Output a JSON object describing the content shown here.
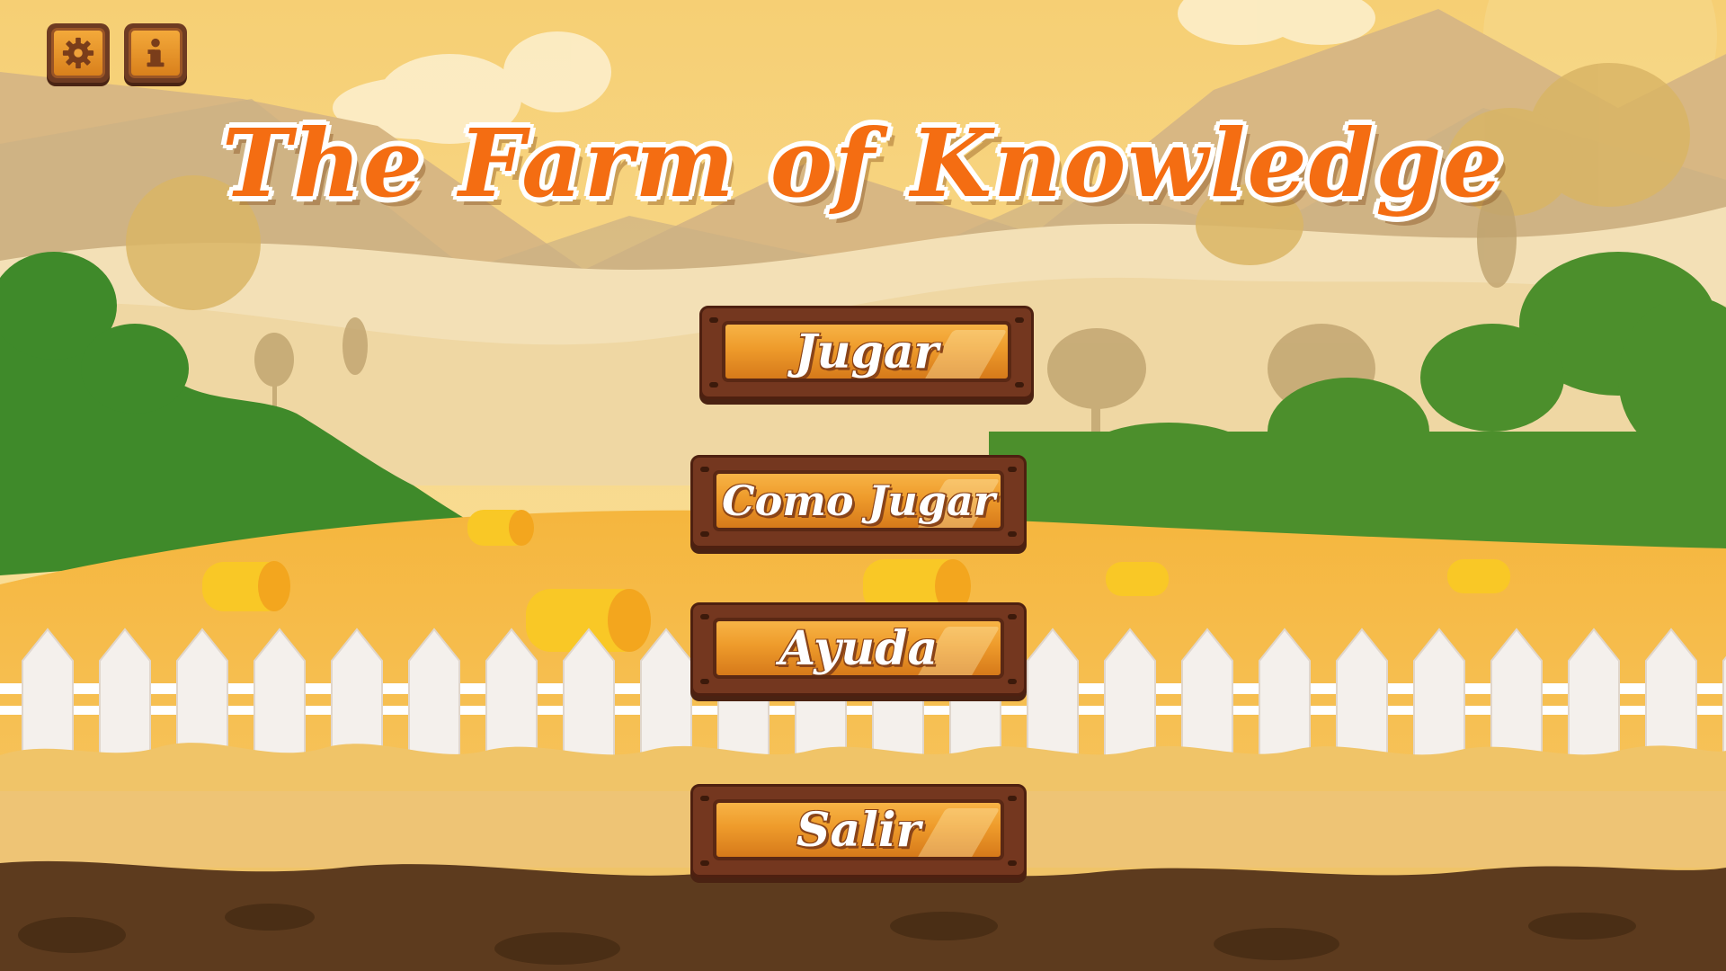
{
  "game": {
    "title": "The Farm of Knowledge"
  },
  "top_bar": {
    "settings_icon": "gear-icon",
    "info_icon": "info-icon"
  },
  "menu": {
    "play_label": "Jugar",
    "how_to_play_label": "Como Jugar",
    "help_label": "Ayuda",
    "exit_label": "Salir"
  },
  "colors": {
    "title": "#f46d12",
    "button_face": "#ee9b2b",
    "button_frame": "#74371f",
    "sky": "#f6d27e",
    "field": "#f0b23c",
    "soil": "#5a3a1e"
  }
}
